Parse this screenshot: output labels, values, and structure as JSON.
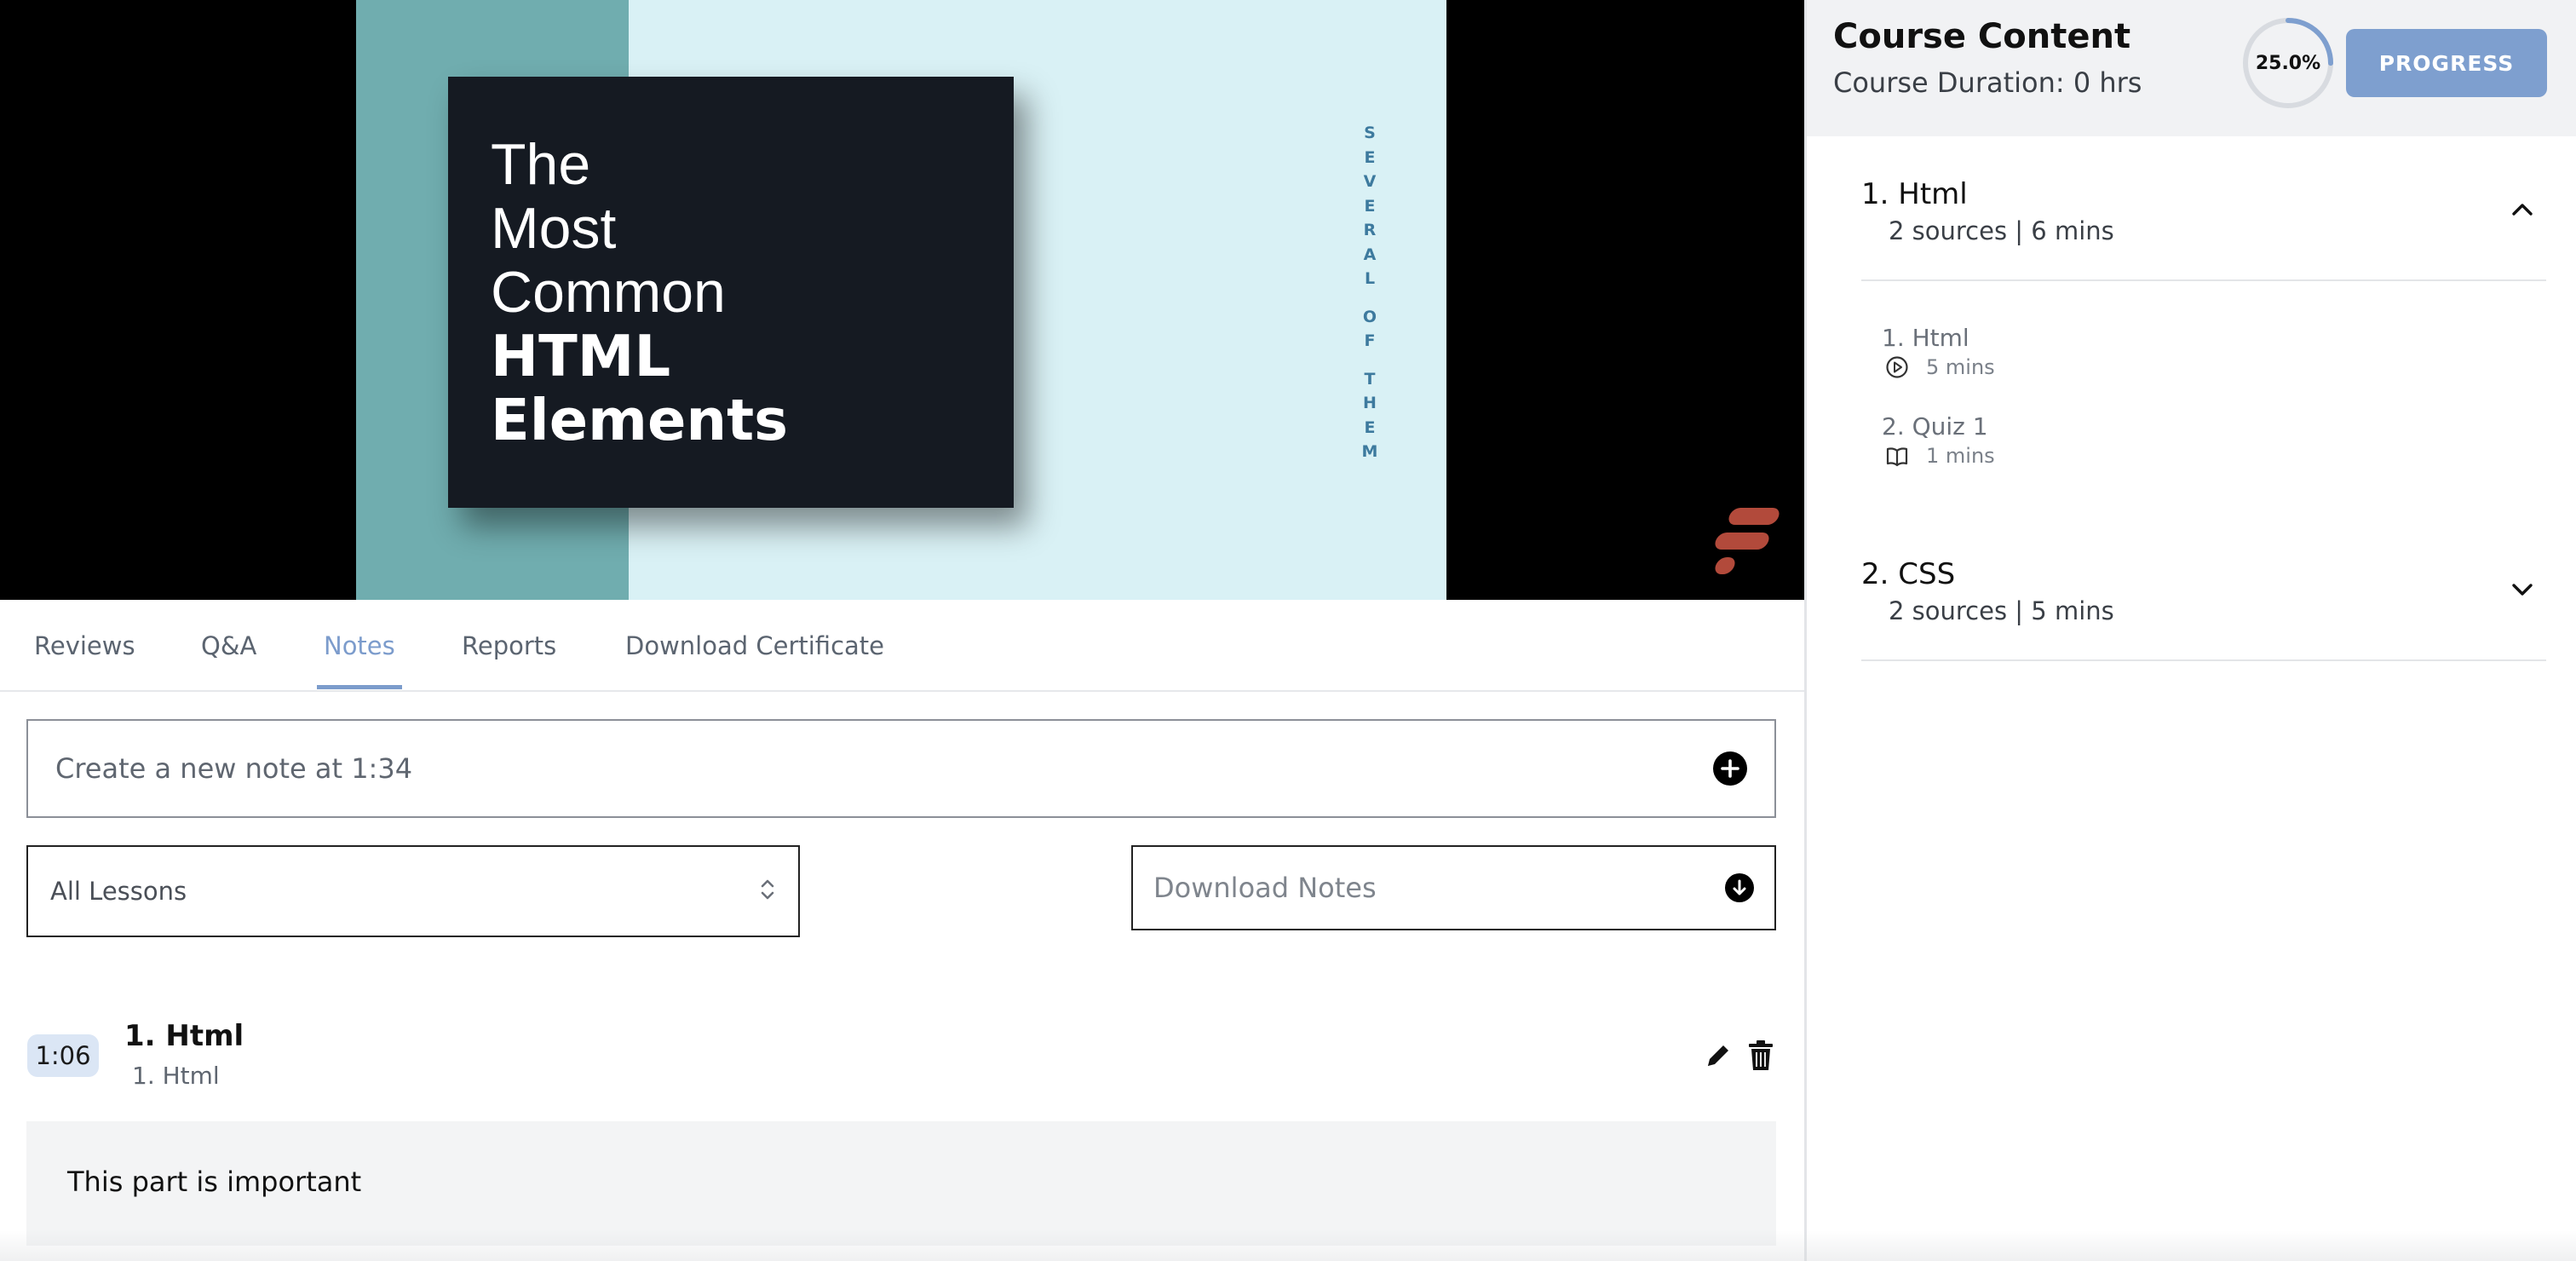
{
  "video": {
    "slide_lines": [
      "The",
      "Most",
      "Common",
      "HTML",
      "Elements"
    ],
    "vertical_words": [
      "SEVERAL",
      "OF",
      "THEM"
    ],
    "colors": {
      "band": "#70adaf",
      "background": "#d9f1f5",
      "card": "#151a22",
      "logo": "#b24a3b"
    }
  },
  "tabs": [
    {
      "label": "Reviews",
      "active": false
    },
    {
      "label": "Q&A",
      "active": false
    },
    {
      "label": "Notes",
      "active": true
    },
    {
      "label": "Reports",
      "active": false
    },
    {
      "label": "Download Certificate",
      "active": false
    }
  ],
  "notes": {
    "create_placeholder": "Create a new note at 1:34",
    "create_icon": "plus-circle-icon",
    "filter_selected": "All Lessons",
    "filter_icon": "up-down-chevron-icon",
    "download_label": "Download Notes",
    "download_icon": "arrow-down-circle-icon",
    "items": [
      {
        "time": "1:06",
        "section": "1. Html",
        "lesson": "1. Html",
        "text": "This part is important",
        "edit_icon": "pencil-icon",
        "delete_icon": "trash-icon"
      }
    ]
  },
  "course": {
    "title": "Course Content",
    "duration": "Course Duration: 0 hrs",
    "progress_value": 25.0,
    "progress_label": "25.0%",
    "progress_button": "PROGRESS",
    "accent_color": "#7e9fcf",
    "sections": [
      {
        "title": "1. Html",
        "meta": "2 sources | 6 mins",
        "expanded": true,
        "lessons": [
          {
            "title": "1. Html",
            "icon": "play-circle-icon",
            "duration": "5 mins"
          },
          {
            "title": "2. Quiz 1",
            "icon": "book-open-icon",
            "duration": "1 mins"
          }
        ]
      },
      {
        "title": "2. CSS",
        "meta": "2 sources | 5 mins",
        "expanded": false,
        "lessons": []
      }
    ]
  }
}
